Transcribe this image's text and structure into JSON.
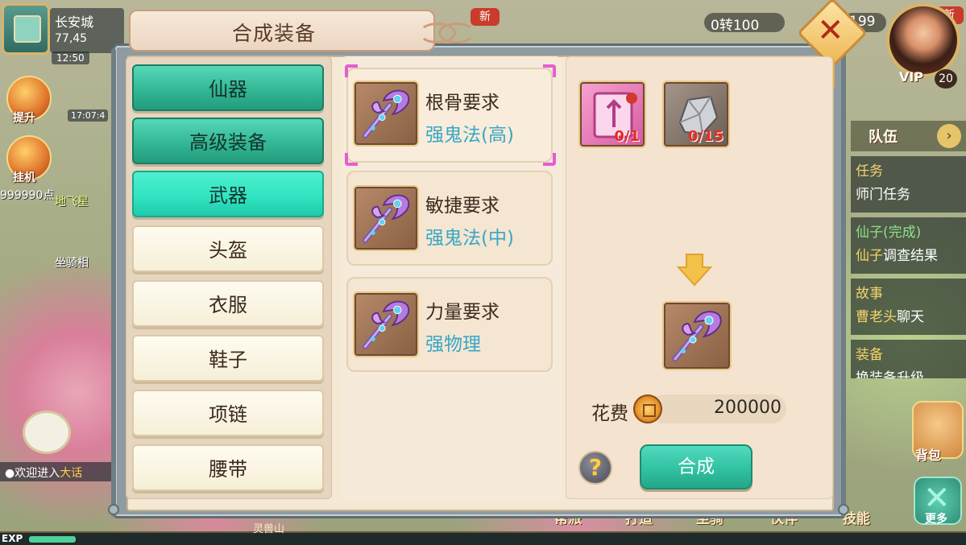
{
  "hud": {
    "city": "长安城",
    "coords": "77,45",
    "time": "12:50",
    "time2": "17:07:4",
    "upgrade_label": "提升",
    "auto_label": "挂机",
    "points": "999990点",
    "char_name": "地飞星",
    "mount_label": "坐骑相",
    "chat_prefix": "●欢迎进入",
    "chat_highlight": "大话",
    "exp_label": "EXP",
    "exp_fraction": 0.05,
    "currency": "0转100",
    "currency2": "199",
    "new_label": "新",
    "vip_label": "VIP",
    "vip_level": "20",
    "team_label": "队伍",
    "team_arrow": "›",
    "quests": [
      {
        "title": "任务",
        "desc": "师门任务",
        "desc_highlight": ""
      },
      {
        "title": "仙子(完成)",
        "desc": "调查结果",
        "desc_highlight": "仙子"
      },
      {
        "title": "故事",
        "desc": "聊天",
        "desc_highlight": "曹老头"
      },
      {
        "title": "装备",
        "desc": "换装备升级",
        "desc_highlight": ""
      }
    ],
    "bag_label": "背包",
    "more_label": "更多",
    "more_icon": "✕",
    "bottom_buttons": [
      "帮派",
      "打造",
      "坐骑",
      "伙伴",
      "技能"
    ],
    "spirit_label": "灵兽山"
  },
  "dialog": {
    "title": "合成装备",
    "close_icon": "✕",
    "categories": [
      "仙器",
      "高级装备",
      "武器",
      "头盔",
      "衣服",
      "鞋子",
      "项链",
      "腰带"
    ],
    "items": [
      {
        "requirement": "根骨要求",
        "type": "强鬼法(高)"
      },
      {
        "requirement": "敏捷要求",
        "type": "强鬼法(中)"
      },
      {
        "requirement": "力量要求",
        "type": "强物理"
      }
    ],
    "materials": [
      {
        "icon": "scroll-icon",
        "count": "0/1"
      },
      {
        "icon": "stone-icon",
        "count": "0/15"
      }
    ],
    "cost_label": "花费",
    "cost_value": "200000",
    "help_icon": "?",
    "craft_label": "合成"
  },
  "colors": {
    "accent_teal": "#2fe2c0",
    "type_blue": "#38a7c6",
    "count_red": "#e52b22",
    "selection_pink": "#e45fd0"
  }
}
